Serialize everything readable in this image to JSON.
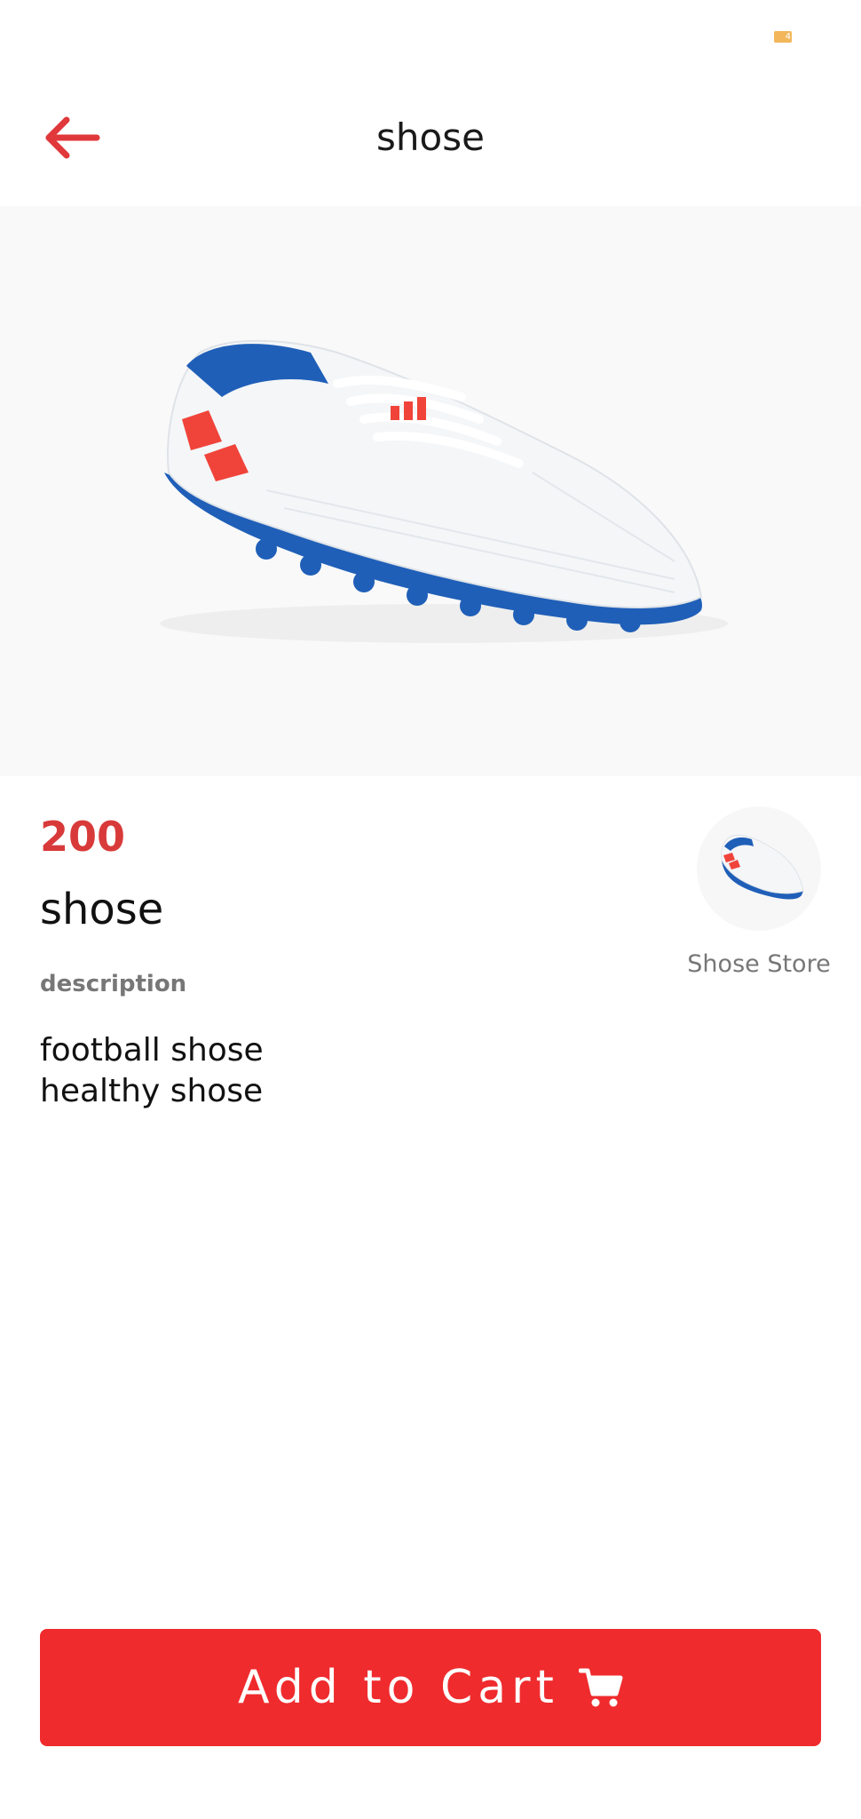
{
  "status_bar": {
    "battery_level": "4"
  },
  "app_bar": {
    "title": "shose",
    "back_icon": "arrow-left-icon"
  },
  "product": {
    "price": "200",
    "name": "shose",
    "description_label": "description",
    "description": "football shose\nhealthy shose",
    "image": "white-blue-red-football-shoe"
  },
  "store": {
    "name": "Shose Store",
    "avatar": "shoe-thumbnail"
  },
  "actions": {
    "add_to_cart_label": "Add to Cart",
    "cart_icon": "shopping-cart-icon"
  },
  "colors": {
    "accent": "#ef2b2d",
    "price": "#d83a3a",
    "muted": "#777777",
    "shoe_blue": "#1f5fb8",
    "shoe_red": "#f0443a"
  }
}
